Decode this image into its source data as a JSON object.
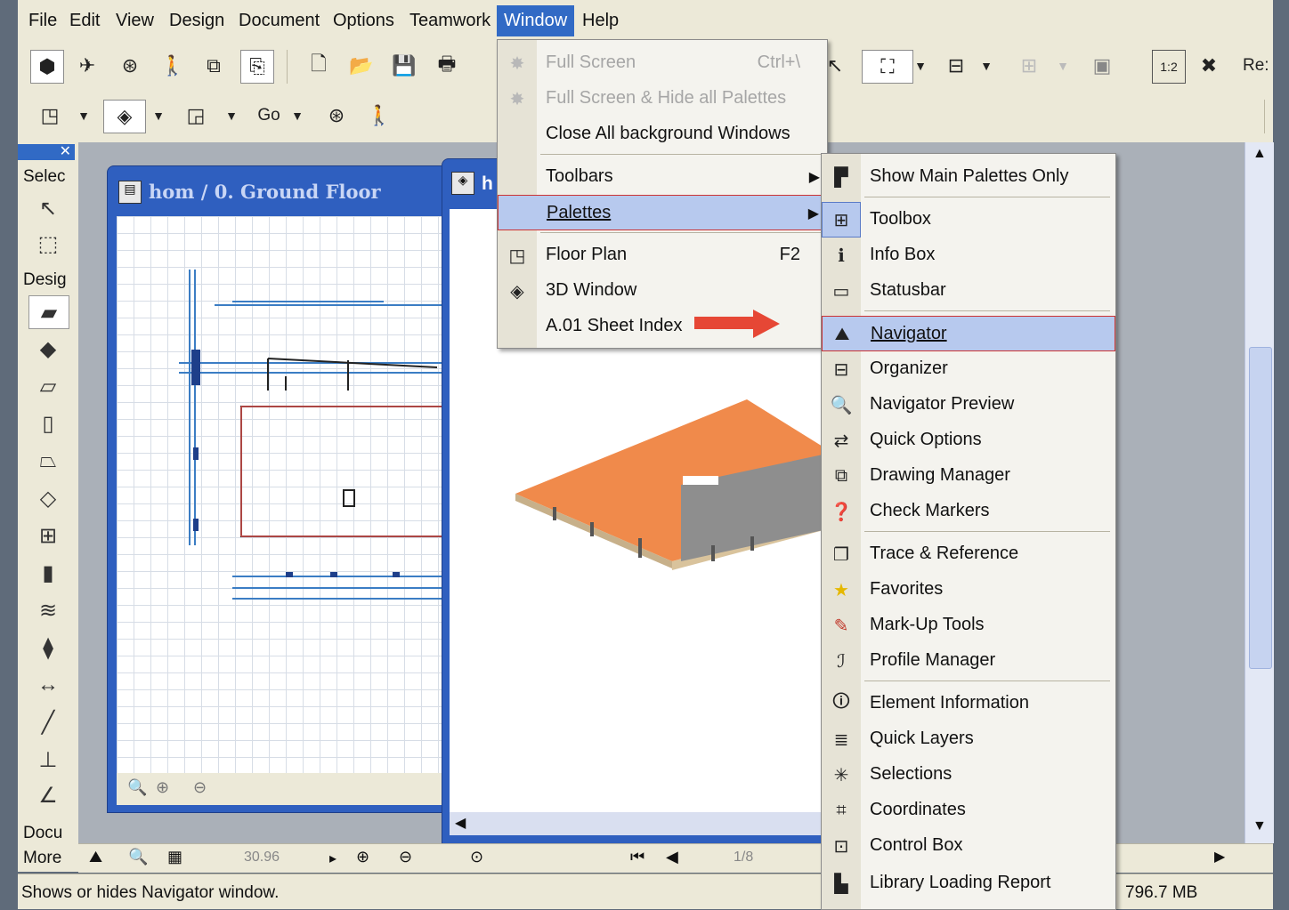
{
  "menubar": {
    "items": [
      "File",
      "Edit",
      "View",
      "Design",
      "Document",
      "Options",
      "Teamwork",
      "Window",
      "Help"
    ],
    "active": "Window"
  },
  "toolbar": {
    "go_label": "Go",
    "right_label": "Re:",
    "ratio_label": "1:2"
  },
  "toolbox": {
    "sections": [
      "Selec",
      "Desig",
      "Docu",
      "More"
    ]
  },
  "windows": {
    "floor_plan_title": "hom / 0. Ground Floor",
    "window3d_title": "h",
    "floor_status_value": "30.96"
  },
  "window3d": {
    "page_value": "1/8"
  },
  "menu_window": {
    "items": [
      {
        "label": "Full Screen",
        "shortcut": "Ctrl+\\",
        "disabled": true,
        "icon": "fullscreen-icon"
      },
      {
        "label": "Full Screen & Hide all Palettes",
        "shortcut": "",
        "disabled": true,
        "icon": "fullscreen-palettes-icon"
      },
      {
        "label": "Close All background Windows",
        "shortcut": "",
        "disabled": false,
        "icon": ""
      },
      {
        "label": "Toolbars",
        "shortcut": "",
        "disabled": false,
        "icon": "",
        "submenu": true
      },
      {
        "label": "Palettes",
        "shortcut": "",
        "disabled": false,
        "icon": "",
        "submenu": true,
        "highlighted": true
      },
      {
        "label": "Floor Plan",
        "shortcut": "F2",
        "disabled": false,
        "icon": "floor-plan-icon"
      },
      {
        "label": "3D Window",
        "shortcut": "",
        "disabled": false,
        "icon": "3d-window-icon"
      },
      {
        "label": "A.01 Sheet Index",
        "shortcut": "",
        "disabled": false,
        "icon": ""
      }
    ]
  },
  "menu_palettes": {
    "items": [
      {
        "label": "Show Main Palettes Only",
        "icon": "main-palettes-icon"
      },
      {
        "label": "Toolbox",
        "icon": "toolbox-icon"
      },
      {
        "label": "Info Box",
        "icon": "info-box-icon"
      },
      {
        "label": "Statusbar",
        "icon": "statusbar-icon"
      },
      {
        "label": "Navigator",
        "icon": "navigator-icon",
        "highlighted": true
      },
      {
        "label": "Organizer",
        "icon": "organizer-icon"
      },
      {
        "label": "Navigator Preview",
        "icon": "navigator-preview-icon"
      },
      {
        "label": "Quick Options",
        "icon": "quick-options-icon"
      },
      {
        "label": "Drawing Manager",
        "icon": "drawing-manager-icon"
      },
      {
        "label": "Check Markers",
        "icon": "check-markers-icon"
      },
      {
        "label": "Trace & Reference",
        "icon": "trace-reference-icon"
      },
      {
        "label": "Favorites",
        "icon": "favorites-icon"
      },
      {
        "label": "Mark-Up Tools",
        "icon": "markup-tools-icon"
      },
      {
        "label": "Profile Manager",
        "icon": "profile-manager-icon"
      },
      {
        "label": "Element Information",
        "icon": "element-information-icon"
      },
      {
        "label": "Quick Layers",
        "icon": "quick-layers-icon"
      },
      {
        "label": "Selections",
        "icon": "selections-icon"
      },
      {
        "label": "Coordinates",
        "icon": "coordinates-icon"
      },
      {
        "label": "Control Box",
        "icon": "control-box-icon"
      },
      {
        "label": "Library Loading Report",
        "icon": "library-loading-report-icon"
      }
    ]
  },
  "statusbar": {
    "message": "Shows or hides Navigator window.",
    "memory": "796.7 MB"
  },
  "colors": {
    "menu_highlight": "#b7c9ee",
    "titlebar": "#2f5fbf",
    "arrow": "#e64735",
    "roof": "#f08a4b"
  }
}
